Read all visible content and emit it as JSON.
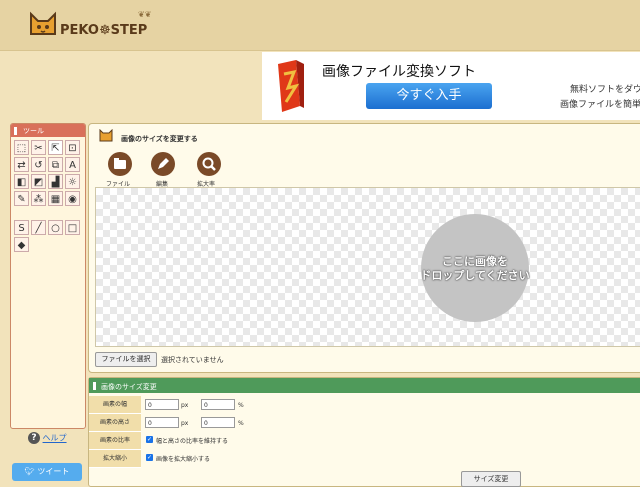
{
  "header": {
    "logo_text": "PEKO☸STEP",
    "paws": "❦❦"
  },
  "ad": {
    "title": "画像ファイル変換ソフト",
    "button": "今すぐ入手",
    "line1": "無料ソフトをダウ",
    "line2": "画像ファイルを簡単"
  },
  "tools": {
    "title": "ツール",
    "items": [
      {
        "icon": "⬚",
        "name": "rect-select"
      },
      {
        "icon": "✂",
        "name": "scissors"
      },
      {
        "icon": "⇱",
        "name": "crop"
      },
      {
        "icon": "⊡",
        "name": "select-frame"
      },
      {
        "icon": "⇄",
        "name": "flip"
      },
      {
        "icon": "↺",
        "name": "rotate"
      },
      {
        "icon": "⧉",
        "name": "duplicate"
      },
      {
        "icon": "A",
        "name": "text"
      },
      {
        "icon": "◧",
        "name": "contrast"
      },
      {
        "icon": "◩",
        "name": "shade"
      },
      {
        "icon": "▟",
        "name": "fill"
      },
      {
        "icon": "☼",
        "name": "brightness"
      },
      {
        "icon": "✎",
        "name": "dropper"
      },
      {
        "icon": "⁂",
        "name": "blur"
      },
      {
        "icon": "▦",
        "name": "mosaic"
      },
      {
        "icon": "◉",
        "name": "color"
      },
      {
        "icon": "S",
        "name": "curve"
      },
      {
        "icon": "╱",
        "name": "line"
      },
      {
        "icon": "○",
        "name": "circle"
      },
      {
        "icon": "□",
        "name": "square"
      },
      {
        "icon": "◆",
        "name": "eraser"
      }
    ]
  },
  "help": {
    "icon": "?",
    "label": "ヘルプ"
  },
  "tweet": {
    "label": "ツイート"
  },
  "main": {
    "title": "画像のサイズを変更する",
    "buttons": [
      {
        "label": "ファイル",
        "glyph": "▰"
      },
      {
        "label": "編集",
        "glyph": "✎"
      },
      {
        "label": "拡大率",
        "glyph": "⚲"
      }
    ],
    "drop_line1": "ここに画像を",
    "drop_line2": "ドロップしてください",
    "file_button": "ファイルを選択",
    "file_status": "選択されていません"
  },
  "resize": {
    "title": "画像のサイズ変更",
    "width_label": "画素の幅",
    "height_label": "画素の高さ",
    "ratio_label": "画素の比率",
    "enlarge_label": "拡大縮小",
    "width_px": "0",
    "width_pct": "0",
    "height_px": "0",
    "height_pct": "0",
    "unit_px": "px",
    "unit_pct": "%",
    "ratio_check": "幅と高さの比率を維持する",
    "enlarge_check": "画像を拡大縮小する",
    "button": "サイズ変更"
  }
}
